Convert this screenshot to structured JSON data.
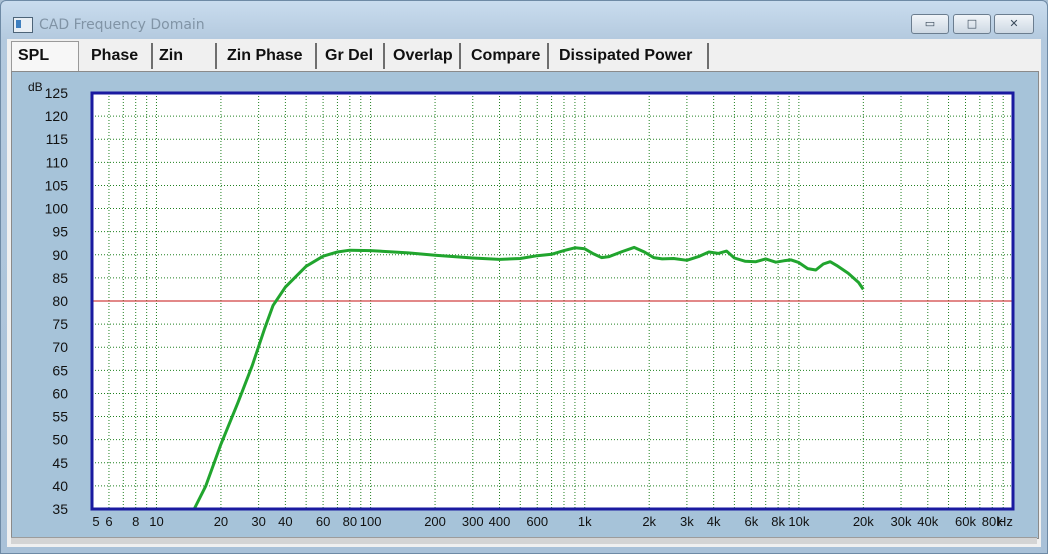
{
  "window": {
    "title": "CAD Frequency Domain",
    "min_glyph": "▭",
    "max_glyph": "□",
    "close_glyph": "✕"
  },
  "tabs": [
    {
      "label": "SPL"
    },
    {
      "label": "Phase"
    },
    {
      "label": "Zin"
    },
    {
      "label": "Zin Phase"
    },
    {
      "label": "Gr Del"
    },
    {
      "label": "Overlap"
    },
    {
      "label": "Compare"
    },
    {
      "label": "Dissipated Power"
    }
  ],
  "chart_data": {
    "type": "line",
    "ylabel": "dB",
    "xscale": "log",
    "xlim": [
      5,
      100000
    ],
    "ylim": [
      35,
      125
    ],
    "y_ticks": [
      35,
      40,
      45,
      50,
      55,
      60,
      65,
      70,
      75,
      80,
      85,
      90,
      95,
      100,
      105,
      110,
      115,
      120,
      125
    ],
    "x_tick_labels": [
      {
        "v": 5,
        "t": "5"
      },
      {
        "v": 6,
        "t": "6"
      },
      {
        "v": 8,
        "t": "8"
      },
      {
        "v": 10,
        "t": "10"
      },
      {
        "v": 20,
        "t": "20"
      },
      {
        "v": 30,
        "t": "30"
      },
      {
        "v": 40,
        "t": "40"
      },
      {
        "v": 60,
        "t": "60"
      },
      {
        "v": 80,
        "t": "80"
      },
      {
        "v": 100,
        "t": "100"
      },
      {
        "v": 200,
        "t": "200"
      },
      {
        "v": 300,
        "t": "300"
      },
      {
        "v": 400,
        "t": "400"
      },
      {
        "v": 600,
        "t": "600"
      },
      {
        "v": 1000,
        "t": "1k"
      },
      {
        "v": 2000,
        "t": "2k"
      },
      {
        "v": 3000,
        "t": "3k"
      },
      {
        "v": 4000,
        "t": "4k"
      },
      {
        "v": 6000,
        "t": "6k"
      },
      {
        "v": 8000,
        "t": "8k"
      },
      {
        "v": 10000,
        "t": "10k"
      },
      {
        "v": 20000,
        "t": "20k"
      },
      {
        "v": 30000,
        "t": "30k"
      },
      {
        "v": 40000,
        "t": "40k"
      },
      {
        "v": 60000,
        "t": "60k"
      },
      {
        "v": 80000,
        "t": "80k"
      },
      {
        "v": 100000,
        "t": "Hz"
      }
    ],
    "reference_line": {
      "y": 80,
      "color": "#d04040"
    },
    "grid": true,
    "colors": {
      "plot_bg": "#ffffff",
      "frame": "#1a1aa0",
      "grid": "#208020",
      "series": "#21a52e"
    },
    "series": [
      {
        "points": [
          [
            5,
            35
          ],
          [
            10,
            35
          ],
          [
            15,
            35
          ],
          [
            17,
            40
          ],
          [
            20,
            49
          ],
          [
            24,
            58
          ],
          [
            28,
            66
          ],
          [
            32,
            74
          ],
          [
            35,
            79
          ],
          [
            40,
            83
          ],
          [
            50,
            87.5
          ],
          [
            60,
            89.7
          ],
          [
            70,
            90.6
          ],
          [
            80,
            91
          ],
          [
            100,
            90.9
          ],
          [
            150,
            90.4
          ],
          [
            200,
            89.9
          ],
          [
            300,
            89.3
          ],
          [
            400,
            89
          ],
          [
            500,
            89.2
          ],
          [
            600,
            89.8
          ],
          [
            700,
            90.1
          ],
          [
            800,
            90.9
          ],
          [
            900,
            91.5
          ],
          [
            1000,
            91.3
          ],
          [
            1100,
            90.2
          ],
          [
            1200,
            89.4
          ],
          [
            1300,
            89.6
          ],
          [
            1500,
            90.7
          ],
          [
            1700,
            91.6
          ],
          [
            1900,
            90.6
          ],
          [
            2100,
            89.4
          ],
          [
            2300,
            89.1
          ],
          [
            2600,
            89.2
          ],
          [
            3000,
            88.8
          ],
          [
            3400,
            89.6
          ],
          [
            3800,
            90.6
          ],
          [
            4200,
            90.3
          ],
          [
            4600,
            90.8
          ],
          [
            5000,
            89.3
          ],
          [
            5600,
            88.6
          ],
          [
            6300,
            88.5
          ],
          [
            7000,
            89.1
          ],
          [
            7800,
            88.4
          ],
          [
            8500,
            88.7
          ],
          [
            9200,
            88.9
          ],
          [
            10000,
            88.3
          ],
          [
            11000,
            87
          ],
          [
            12000,
            86.7
          ],
          [
            13000,
            88
          ],
          [
            14000,
            88.5
          ],
          [
            15000,
            87.7
          ],
          [
            17000,
            86
          ],
          [
            19000,
            84
          ],
          [
            20000,
            82.5
          ]
        ]
      }
    ]
  }
}
